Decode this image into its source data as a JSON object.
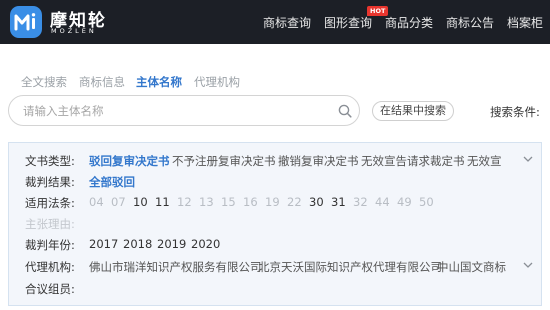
{
  "header": {
    "brand": "摩知轮",
    "brand_sub": "MOZLEN",
    "nav": [
      "商标查询",
      "图形查询",
      "商品分类",
      "商标公告",
      "档案柜"
    ],
    "hot_badge": "HOT"
  },
  "tabs": [
    "全文搜索",
    "商标信息",
    "主体名称",
    "代理机构"
  ],
  "active_tab": "主体名称",
  "search": {
    "placeholder": "请输入主体名称",
    "value": "",
    "in_results_label": "在结果中搜索",
    "conditions_label": "搜索条件:"
  },
  "filters": {
    "doc_type": {
      "label": "文书类型:",
      "options": [
        "驳回复审决定书",
        "不予注册复审决定书",
        "撤销复审决定书",
        "无效宣告请求裁定书",
        "无效宣"
      ],
      "selected": "驳回复审决定书"
    },
    "result": {
      "label": "裁判结果:",
      "options": [
        "全部驳回"
      ],
      "selected": "全部驳回"
    },
    "law": {
      "label": "适用法条:",
      "options": [
        "04",
        "07",
        "10",
        "11",
        "12",
        "13",
        "15",
        "16",
        "19",
        "22",
        "30",
        "31",
        "32",
        "44",
        "49",
        "50"
      ],
      "emphasized": [
        "10",
        "11",
        "30",
        "31"
      ]
    },
    "reason": {
      "label": "主张理由:"
    },
    "year": {
      "label": "裁判年份:",
      "options": [
        "2017",
        "2018",
        "2019",
        "2020"
      ]
    },
    "agency": {
      "label": "代理机构:",
      "options": [
        "佛山市瑞洋知识产权服务有限公司",
        "北京天沃国际知识产权代理有限公司",
        "中山国文商标"
      ]
    },
    "panel": {
      "label": "合议组员:"
    }
  },
  "colors": {
    "topbar": "#1c1f26",
    "accent": "#3377cc",
    "logo": "#3a8ee6",
    "hot": "#e8352e",
    "panel_bg": "#f3f6fb"
  },
  "icons": [
    "logo-m-icon",
    "search-icon",
    "chevron-down-icon"
  ]
}
